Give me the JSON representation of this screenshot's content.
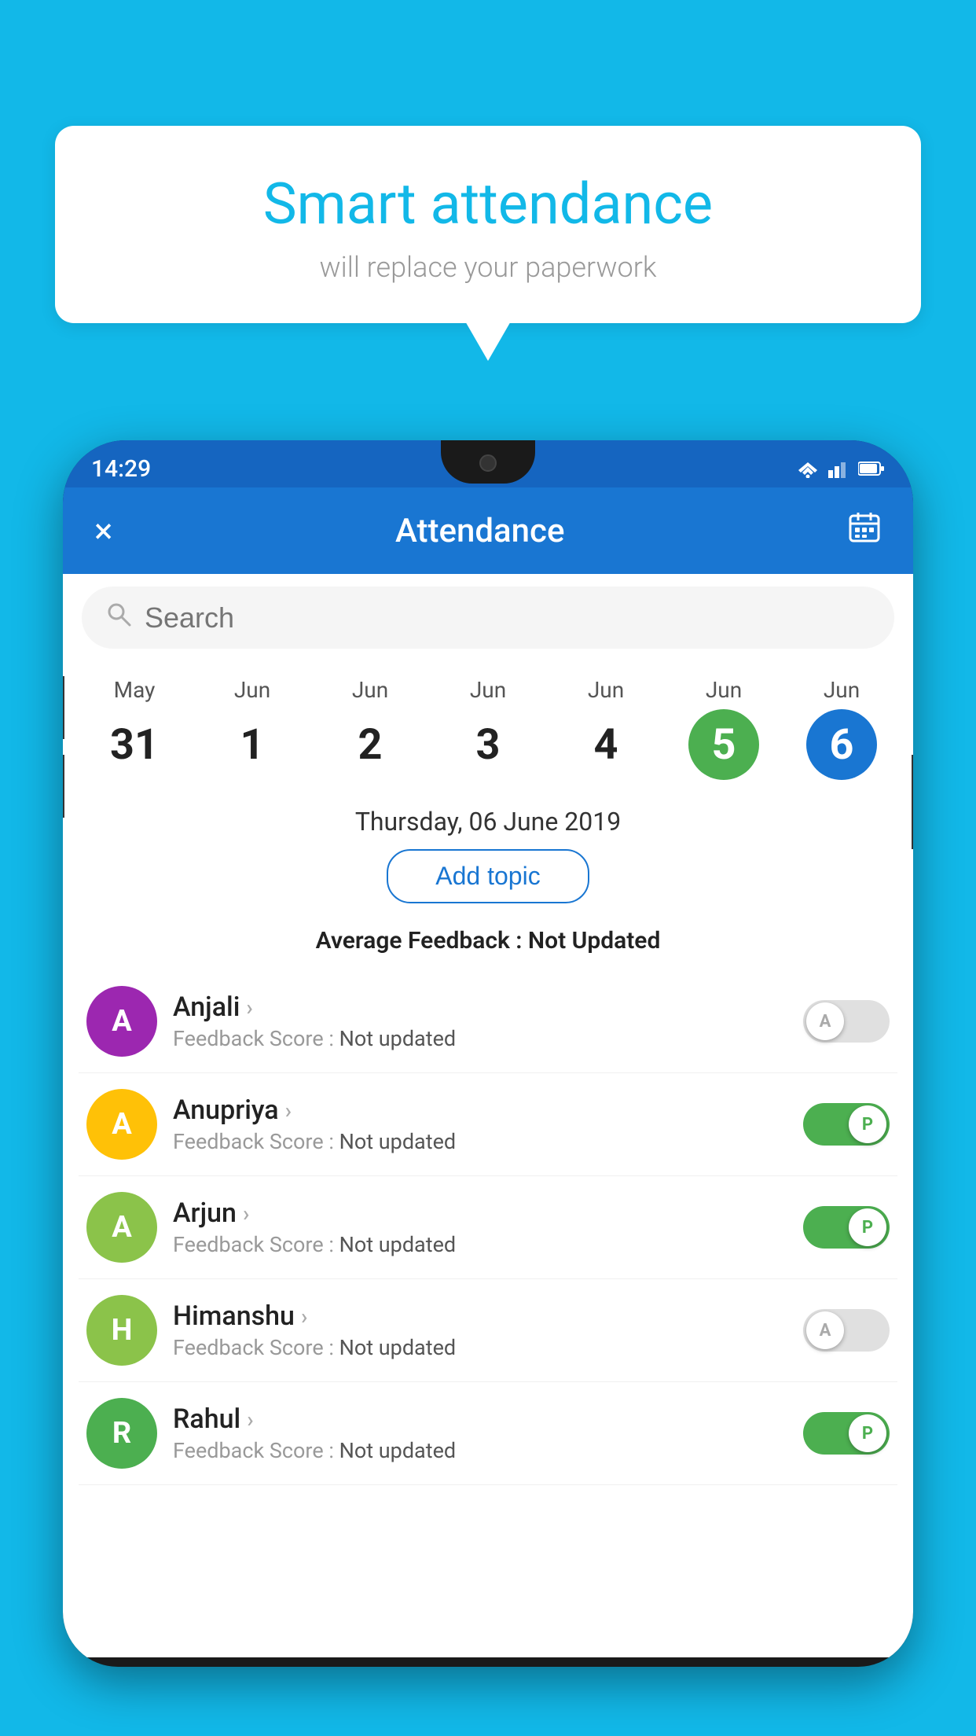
{
  "background_color": "#12B8E8",
  "bubble": {
    "title": "Smart attendance",
    "subtitle": "will replace your paperwork"
  },
  "status_bar": {
    "time": "14:29"
  },
  "app_bar": {
    "title": "Attendance",
    "close_label": "×",
    "calendar_label": "📅"
  },
  "search": {
    "placeholder": "Search"
  },
  "calendar": {
    "days": [
      {
        "month": "May",
        "date": "31",
        "style": "normal"
      },
      {
        "month": "Jun",
        "date": "1",
        "style": "normal"
      },
      {
        "month": "Jun",
        "date": "2",
        "style": "normal"
      },
      {
        "month": "Jun",
        "date": "3",
        "style": "normal"
      },
      {
        "month": "Jun",
        "date": "4",
        "style": "normal"
      },
      {
        "month": "Jun",
        "date": "5",
        "style": "today"
      },
      {
        "month": "Jun",
        "date": "6",
        "style": "selected"
      }
    ]
  },
  "selected_date": "Thursday, 06 June 2019",
  "add_topic_label": "Add topic",
  "avg_feedback_label": "Average Feedback :",
  "avg_feedback_value": "Not Updated",
  "students": [
    {
      "name": "Anjali",
      "initial": "A",
      "avatar_color": "#9C27B0",
      "feedback_label": "Feedback Score :",
      "feedback_value": "Not updated",
      "toggle": "off",
      "toggle_label": "A"
    },
    {
      "name": "Anupriya",
      "initial": "A",
      "avatar_color": "#FFC107",
      "feedback_label": "Feedback Score :",
      "feedback_value": "Not updated",
      "toggle": "on",
      "toggle_label": "P"
    },
    {
      "name": "Arjun",
      "initial": "A",
      "avatar_color": "#8BC34A",
      "feedback_label": "Feedback Score :",
      "feedback_value": "Not updated",
      "toggle": "on",
      "toggle_label": "P"
    },
    {
      "name": "Himanshu",
      "initial": "H",
      "avatar_color": "#8BC34A",
      "feedback_label": "Feedback Score :",
      "feedback_value": "Not updated",
      "toggle": "off",
      "toggle_label": "A"
    },
    {
      "name": "Rahul",
      "initial": "R",
      "avatar_color": "#4CAF50",
      "feedback_label": "Feedback Score :",
      "feedback_value": "Not updated",
      "toggle": "on",
      "toggle_label": "P"
    }
  ]
}
